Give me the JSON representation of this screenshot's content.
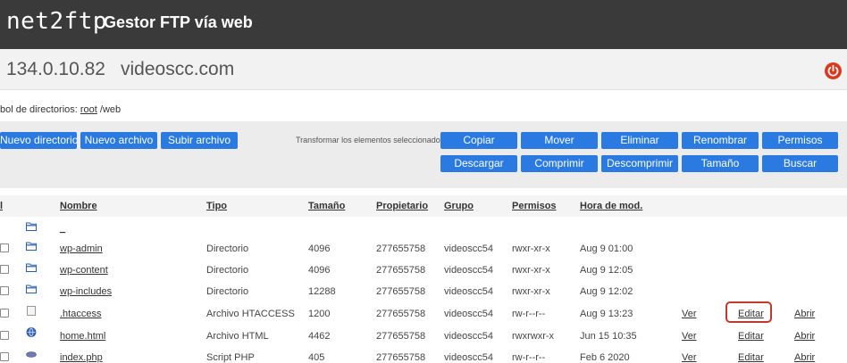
{
  "header": {
    "logo": "net2ftp",
    "tagline": "Gestor FTP vía web"
  },
  "server": {
    "ip": "134.0.10.82",
    "host": "videoscc.com"
  },
  "breadcrumb": {
    "prefix": "bol de directorios:",
    "root": "root",
    "path": "/web"
  },
  "toolbar": {
    "new_dir": "Nuevo directorio",
    "new_file": "Nuevo archivo",
    "upload": "Subir archivo",
    "transform_label": "Transformar los elementos seleccionados:",
    "actions_row1": [
      "Copiar",
      "Mover",
      "Eliminar",
      "Renombrar",
      "Permisos"
    ],
    "actions_row2": [
      "Descargar",
      "Comprimir",
      "Descomprimir",
      "Tamaño",
      "Buscar"
    ]
  },
  "table": {
    "select_all": "l",
    "columns": [
      "Nombre",
      "Tipo",
      "Tamaño",
      "Propietario",
      "Grupo",
      "Permisos",
      "Hora de mod."
    ],
    "parent_dir": "_",
    "action_labels": {
      "view": "Ver",
      "edit": "Editar",
      "open": "Abrir"
    },
    "rows": [
      {
        "name": "wp-admin",
        "type": "Directorio",
        "size": "4096",
        "owner": "277655758",
        "group": "videoscc54",
        "perms": "rwxr-xr-x",
        "mtime": "Aug 9 01:00",
        "icon": "folder-icon"
      },
      {
        "name": "wp-content",
        "type": "Directorio",
        "size": "4096",
        "owner": "277655758",
        "group": "videoscc54",
        "perms": "rwxr-xr-x",
        "mtime": "Aug 9 12:05",
        "icon": "folder-icon"
      },
      {
        "name": "wp-includes",
        "type": "Directorio",
        "size": "12288",
        "owner": "277655758",
        "group": "videoscc54",
        "perms": "rwxr-xr-x",
        "mtime": "Aug 9 12:02",
        "icon": "folder-icon"
      },
      {
        "name": ".htaccess",
        "type": "Archivo HTACCESS",
        "size": "1200",
        "owner": "277655758",
        "group": "videoscc54",
        "perms": "rw-r--r--",
        "mtime": "Aug 9 13:23",
        "icon": "file-icon"
      },
      {
        "name": "home.html",
        "type": "Archivo HTML",
        "size": "4462",
        "owner": "277655758",
        "group": "videoscc54",
        "perms": "rwxrwxr-x",
        "mtime": "Jun 15 10:35",
        "icon": "globe-icon"
      },
      {
        "name": "index.php",
        "type": "Script PHP",
        "size": "405",
        "owner": "277655758",
        "group": "videoscc54",
        "perms": "rw-r--r--",
        "mtime": "Feb 6 2020",
        "icon": "php-icon"
      }
    ]
  },
  "colors": {
    "header_bg": "#3a3a3a",
    "button": "#2a7ae2",
    "power": "#d9391f",
    "highlight": "#c0392b"
  }
}
